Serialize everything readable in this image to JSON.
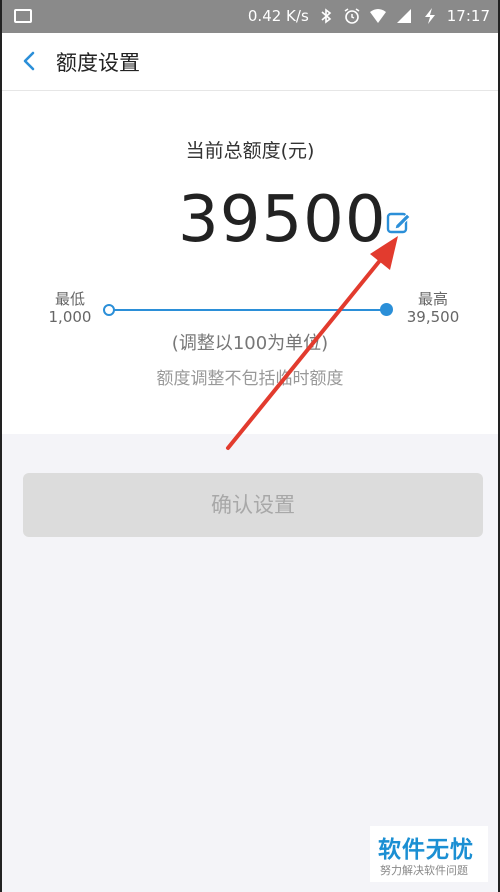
{
  "status_bar": {
    "speed": "0.42 K/s",
    "time": "17:17"
  },
  "header": {
    "title": "额度设置"
  },
  "limit": {
    "label": "当前总额度(元)",
    "amount": "39500",
    "min_label": "最低",
    "min_value": "1,000",
    "max_label": "最高",
    "max_value": "39,500",
    "slider_fraction": 1.0,
    "hint_step": "(调整以100为单位)",
    "hint_note": "额度调整不包括临时额度"
  },
  "actions": {
    "confirm_label": "确认设置"
  },
  "watermark": {
    "main": "软件无忧",
    "sub": "努力解决软件问题"
  },
  "colors": {
    "accent": "#2b8fd8",
    "annotation_arrow": "#e23b2e"
  },
  "icons": [
    "gallery-icon",
    "bluetooth-icon",
    "alarm-icon",
    "wifi-icon",
    "signal-icon",
    "charging-icon",
    "back-arrow-icon",
    "edit-icon"
  ]
}
